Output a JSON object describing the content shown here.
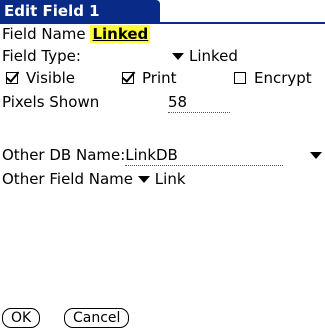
{
  "title": "Edit Field 1",
  "field_name": {
    "label": "Field Name",
    "value": "Linked"
  },
  "field_type": {
    "label": "Field Type:",
    "value": "Linked",
    "icon": "dropdown-triangle-icon"
  },
  "options": {
    "visible": {
      "label": "Visible",
      "checked": true
    },
    "print": {
      "label": "Print",
      "checked": true
    },
    "encrypt": {
      "label": "Encrypt",
      "checked": false
    }
  },
  "pixels_shown": {
    "label": "Pixels Shown",
    "value": "58"
  },
  "other_db": {
    "label": "Other DB Name:",
    "value": "LinkDB",
    "icon": "dropdown-triangle-icon"
  },
  "other_field": {
    "label": "Other Field Name",
    "value": "Link",
    "icon": "dropdown-triangle-icon"
  },
  "buttons": {
    "ok": "OK",
    "cancel": "Cancel"
  },
  "colors": {
    "title_bg": "#0a2a87",
    "highlight": "#ffff33"
  }
}
